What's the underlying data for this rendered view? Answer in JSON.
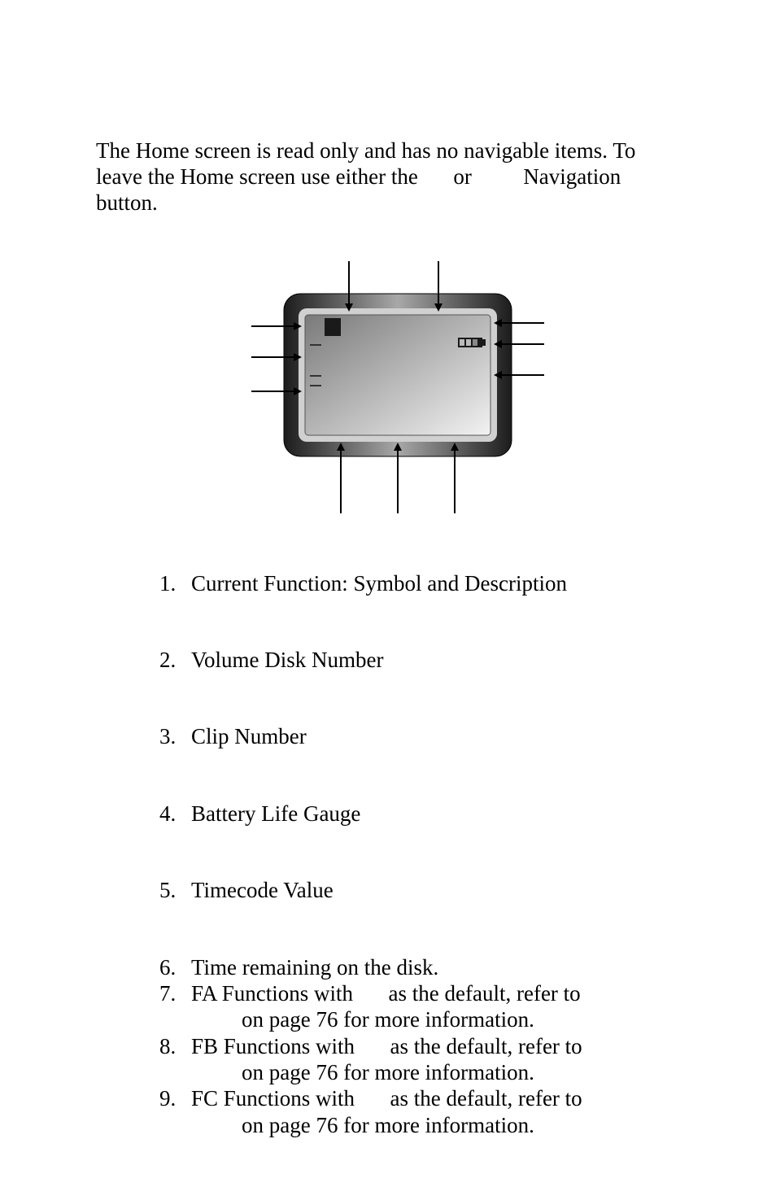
{
  "intro": {
    "line1": "The Home screen is read only and has no navigable items. To",
    "line2a": "leave the Home screen use either the",
    "line2b": "or",
    "line2c": "Navigation",
    "line3": "button."
  },
  "legend": {
    "item1": "Current Function: Symbol and Description",
    "item2": "Volume Disk Number",
    "item3": "Clip Number",
    "item4": "Battery Life Gauge",
    "item5": "Timecode Value",
    "item6": "Time remaining on the disk.",
    "item7a": "FA Functions with",
    "item7b": "as the default, refer to",
    "item7c": "on page 76 for more information.",
    "item8a": "FB Functions with",
    "item8b": "as the default, refer to",
    "item8c": "on page 76 for more information.",
    "item9a": "FC Functions with",
    "item9b": "as the default, refer to",
    "item9c": "on page 76 for more information."
  }
}
